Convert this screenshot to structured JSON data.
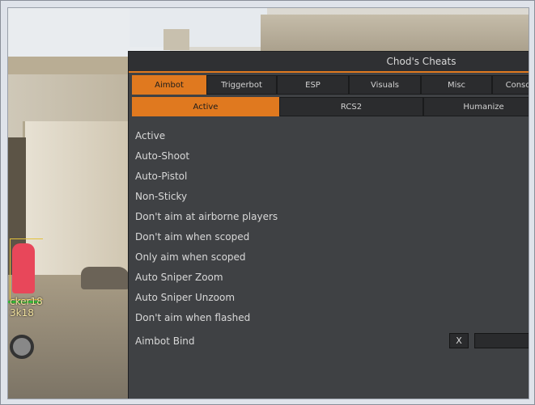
{
  "menu": {
    "title": "Chod's Cheats",
    "tabs": [
      {
        "label": "Aimbot",
        "active": true
      },
      {
        "label": "Triggerbot",
        "active": false
      },
      {
        "label": "ESP",
        "active": false
      },
      {
        "label": "Visuals",
        "active": false
      },
      {
        "label": "Misc",
        "active": false
      },
      {
        "label": "Conso",
        "active": false
      }
    ],
    "subtabs": [
      {
        "label": "Active",
        "active": true
      },
      {
        "label": "RCS2",
        "active": false
      },
      {
        "label": "Humanize",
        "active": false
      }
    ],
    "options": [
      "Active",
      "Auto-Shoot",
      "Auto-Pistol",
      "Non-Sticky",
      "Don't aim at airborne players",
      "Don't aim when scoped",
      "Only aim when scoped",
      "Auto Sniper Zoom",
      "Auto Sniper Unzoom",
      "Don't aim when flashed"
    ],
    "bind": {
      "label": "Aimbot Bind",
      "clear": "X",
      "value": ""
    }
  },
  "esp": {
    "name": "cker18",
    "subtext": "3k18"
  },
  "colors": {
    "accent": "#e0791f",
    "panel": "#3f4144",
    "enemy": "#e8475a"
  }
}
